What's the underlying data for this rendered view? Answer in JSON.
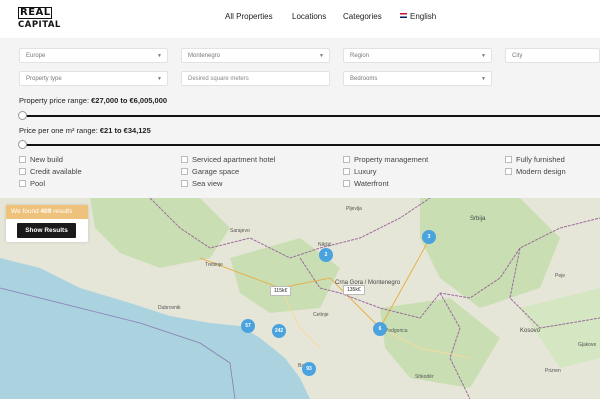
{
  "header": {
    "logo_line1": "REAL",
    "logo_line2": "CAPITAL",
    "nav": [
      "All Properties",
      "Locations",
      "Categories",
      "English"
    ]
  },
  "filters": {
    "selects": {
      "continent": "Europe",
      "country": "Montenegro",
      "region": "Region",
      "city": "City",
      "property_type": "Property type",
      "bedrooms": "Bedrooms"
    },
    "sqm_placeholder": "Desired square meters",
    "price_range": {
      "label": "Property price range:",
      "value": "€27,000 to €6,005,000"
    },
    "sqm_price_range": {
      "label": "Price per one m² range:",
      "value": "€21 to €34,125"
    },
    "features": [
      "New build",
      "Serviced apartment hotel",
      "Property management",
      "Fully furnished",
      "Credit available",
      "Garage space",
      "Luxury",
      "Modern design",
      "Pool",
      "Sea view",
      "Waterfront"
    ]
  },
  "results": {
    "prefix": "We found",
    "count": "409",
    "suffix": "results",
    "button": "Show Results"
  },
  "map": {
    "clusters": [
      "2",
      "3",
      "57",
      "242",
      "6",
      "93"
    ],
    "price_tags": [
      "115k€",
      "135k€"
    ],
    "place_labels": [
      "Sarajevo",
      "Trebinje",
      "Dubrovnik",
      "Nikšić",
      "Crna Gora / Montenegro",
      "Podgorica",
      "Cetinje",
      "Bar",
      "Pljevlja",
      "Kosovo",
      "Prizren",
      "Peje",
      "Gjakove",
      "Shkodër",
      "Srbija"
    ],
    "colors": {
      "sea": "#aad3df",
      "land": "#e6e6d8",
      "forest": "#b6d6a4",
      "border": "#8b5a8b",
      "cluster": "#4aa3df"
    }
  }
}
